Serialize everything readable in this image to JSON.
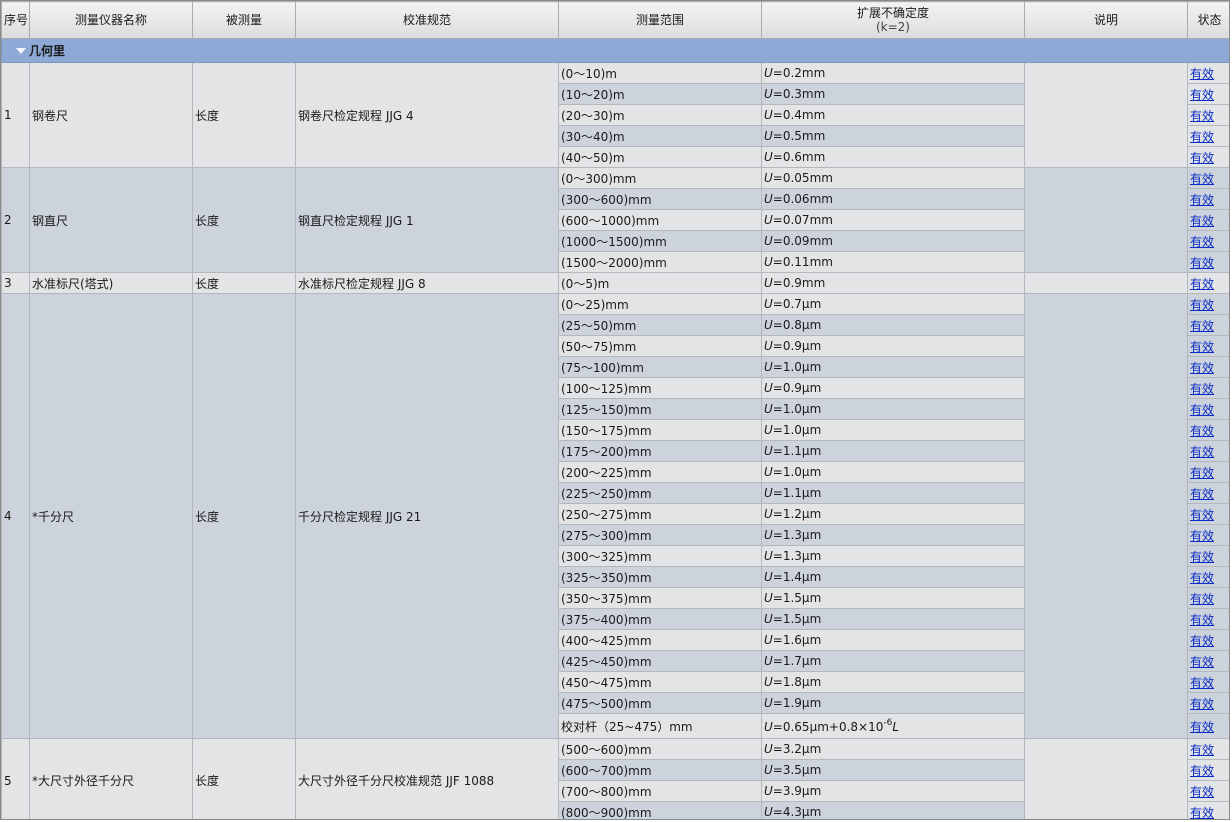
{
  "headers": {
    "seq": "序号",
    "name": "测量仪器名称",
    "quantity": "被测量",
    "spec": "校准规范",
    "range": "测量范围",
    "unc_line1": "扩展不确定度",
    "unc_line2": "(k=2)",
    "note": "说明",
    "status": "状态"
  },
  "group": {
    "label": "几何里"
  },
  "status_label": "有效",
  "instruments": [
    {
      "seq": "1",
      "name": "钢卷尺",
      "quantity": "长度",
      "spec": "钢卷尺检定规程 JJG 4",
      "note": "",
      "rows": [
        {
          "range": "(0～10)m",
          "unc": "=0.2mm"
        },
        {
          "range": "(10～20)m",
          "unc": "=0.3mm"
        },
        {
          "range": "(20～30)m",
          "unc": "=0.4mm"
        },
        {
          "range": "(30～40)m",
          "unc": "=0.5mm"
        },
        {
          "range": "(40～50)m",
          "unc": "=0.6mm"
        }
      ]
    },
    {
      "seq": "2",
      "name": "钢直尺",
      "quantity": "长度",
      "spec": "钢直尺检定规程 JJG 1",
      "note": "",
      "rows": [
        {
          "range": "(0～300)mm",
          "unc": "=0.05mm"
        },
        {
          "range": "(300～600)mm",
          "unc": "=0.06mm"
        },
        {
          "range": "(600～1000)mm",
          "unc": "=0.07mm"
        },
        {
          "range": "(1000～1500)mm",
          "unc": "=0.09mm"
        },
        {
          "range": "(1500～2000)mm",
          "unc": "=0.11mm"
        }
      ]
    },
    {
      "seq": "3",
      "name": "水准标尺(塔式)",
      "quantity": "长度",
      "spec": "水准标尺检定规程 JJG 8",
      "note": "",
      "rows": [
        {
          "range": "(0～5)m",
          "unc": "=0.9mm"
        }
      ]
    },
    {
      "seq": "4",
      "name": "*千分尺",
      "quantity": "长度",
      "spec": "千分尺检定规程 JJG 21",
      "note": "",
      "rows": [
        {
          "range": "(0～25)mm",
          "unc": "=0.7μm"
        },
        {
          "range": "(25～50)mm",
          "unc": "=0.8μm"
        },
        {
          "range": "(50～75)mm",
          "unc": "=0.9μm"
        },
        {
          "range": "(75～100)mm",
          "unc": "=1.0μm"
        },
        {
          "range": "(100～125)mm",
          "unc": "=0.9μm"
        },
        {
          "range": "(125～150)mm",
          "unc": "=1.0μm"
        },
        {
          "range": "(150～175)mm",
          "unc": "=1.0μm"
        },
        {
          "range": "(175～200)mm",
          "unc": "=1.1μm"
        },
        {
          "range": "(200～225)mm",
          "unc": "=1.0μm"
        },
        {
          "range": "(225～250)mm",
          "unc": "=1.1μm"
        },
        {
          "range": "(250～275)mm",
          "unc": "=1.2μm"
        },
        {
          "range": "(275～300)mm",
          "unc": "=1.3μm"
        },
        {
          "range": "(300～325)mm",
          "unc": "=1.3μm"
        },
        {
          "range": "(325～350)mm",
          "unc": "=1.4μm"
        },
        {
          "range": "(350～375)mm",
          "unc": "=1.5μm"
        },
        {
          "range": "(375～400)mm",
          "unc": "=1.5μm"
        },
        {
          "range": "(400～425)mm",
          "unc": "=1.6μm"
        },
        {
          "range": "(425～450)mm",
          "unc": "=1.7μm"
        },
        {
          "range": "(450～475)mm",
          "unc": "=1.8μm"
        },
        {
          "range": "(475～500)mm",
          "unc": "=1.9μm"
        },
        {
          "range": "校对杆（25~475）mm",
          "unc": "=0.65μm+0.8×10",
          "exp": "-6",
          "tail": "L",
          "tall": true
        }
      ]
    },
    {
      "seq": "5",
      "name": "*大尺寸外径千分尺",
      "quantity": "长度",
      "spec": "大尺寸外径千分尺校准规范 JJF 1088",
      "note": "",
      "rows": [
        {
          "range": "(500～600)mm",
          "unc": "=3.2μm"
        },
        {
          "range": "(600～700)mm",
          "unc": "=3.5μm"
        },
        {
          "range": "(700～800)mm",
          "unc": "=3.9μm"
        },
        {
          "range": "(800～900)mm",
          "unc": "=4.3μm"
        }
      ]
    }
  ]
}
